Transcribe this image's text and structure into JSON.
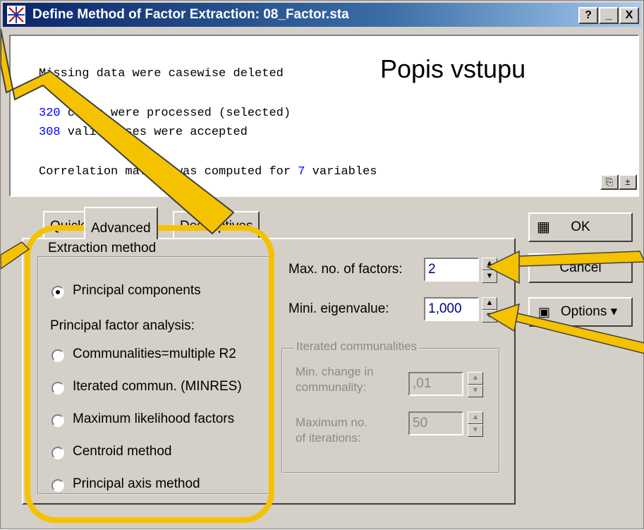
{
  "window": {
    "title": "Define Method of Factor Extraction: 08_Factor.sta",
    "help_btn": "?",
    "minimize_btn": "_",
    "close_btn": "X"
  },
  "annotation": {
    "caption": "Popis vstupu",
    "color": "#f5c200"
  },
  "output": {
    "line1": "Missing data were casewise deleted",
    "line2_num": "320",
    "line2_text": " cases were processed (selected)",
    "line3_num": "308",
    "line3_text": " valid cases were accepted",
    "line4_text": "Correlation matrix was computed for ",
    "line4_num": "7",
    "line4_end": " variables"
  },
  "tabs": [
    "Quick",
    "Advanced",
    "Descriptives"
  ],
  "extraction": {
    "legend": "Extraction method",
    "principal_components": "Principal components",
    "principal_factor_heading": "Principal factor analysis:",
    "options": [
      "Communalities=multiple R2",
      "Iterated commun. (MINRES)",
      "Maximum likelihood factors",
      "Centroid method",
      "Principal axis method"
    ]
  },
  "max_factors": {
    "label": "Max. no. of factors:",
    "value": "2"
  },
  "min_eigen": {
    "label": "Mini. eigenvalue:",
    "value": "1,000"
  },
  "iterated": {
    "legend": "Iterated communalities",
    "min_change_label1": "Min. change in",
    "min_change_label2": "communality:",
    "min_change_value": ",01",
    "max_iter_label1": "Maximum no.",
    "max_iter_label2": "of iterations:",
    "max_iter_value": "50"
  },
  "buttons": {
    "ok": "OK",
    "cancel": "Cancel",
    "options": "Options ▾"
  }
}
